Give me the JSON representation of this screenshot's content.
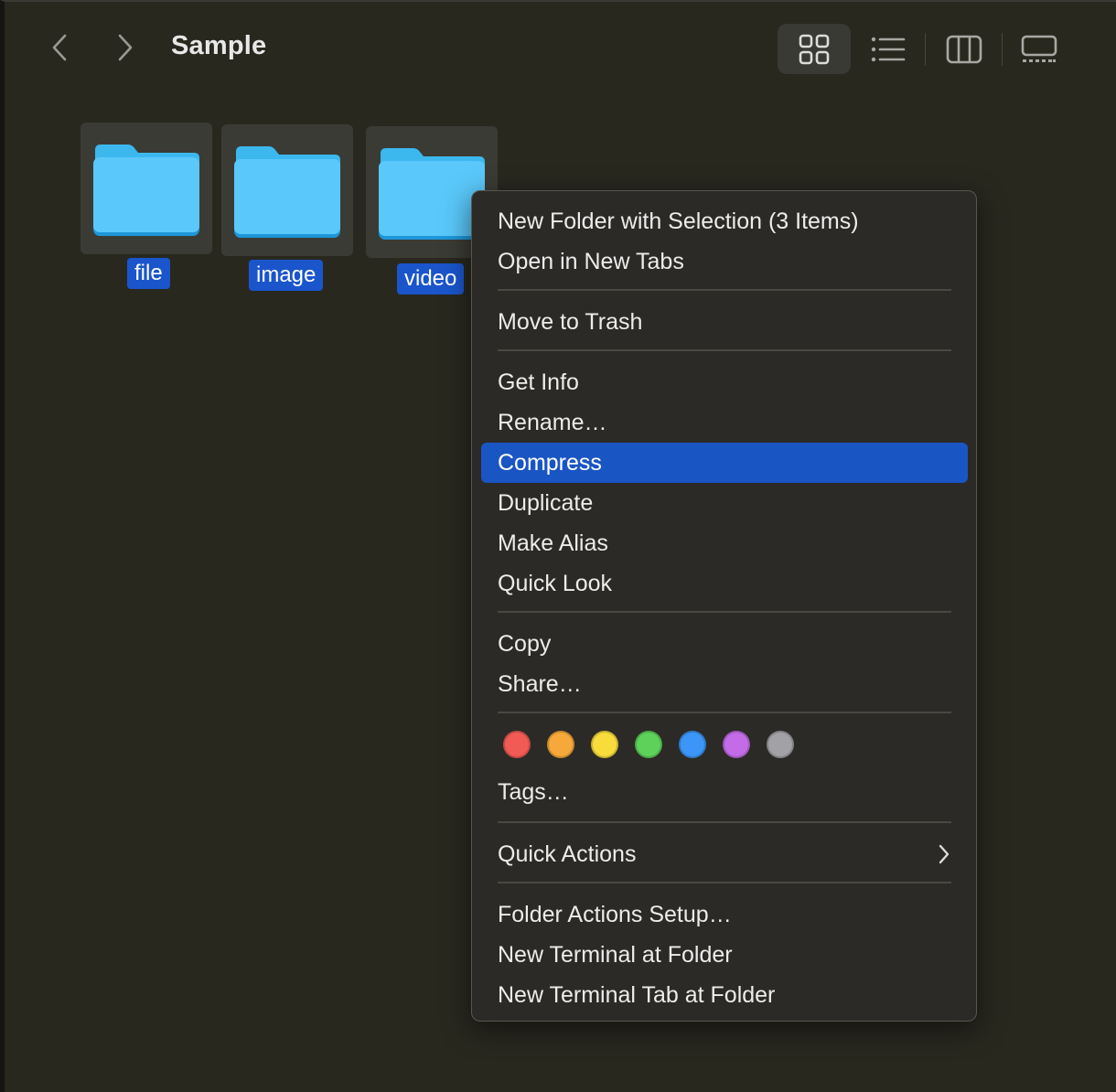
{
  "window": {
    "title": "Sample"
  },
  "toolbar": {
    "back_icon": "chevron-left-icon",
    "forward_icon": "chevron-right-icon",
    "views": [
      {
        "id": "icon",
        "icon": "grid-view-icon",
        "active": true
      },
      {
        "id": "list",
        "icon": "list-view-icon",
        "active": false
      },
      {
        "id": "column",
        "icon": "column-view-icon",
        "active": false
      },
      {
        "id": "gallery",
        "icon": "gallery-view-icon",
        "active": false
      }
    ]
  },
  "folders": [
    {
      "name": "file",
      "selected": true
    },
    {
      "name": "image",
      "selected": true
    },
    {
      "name": "video",
      "selected": true
    }
  ],
  "context_menu": {
    "items": [
      "New Folder with Selection (3 Items)",
      "Open in New Tabs",
      "Move to Trash",
      "Get Info",
      "Rename…",
      "Compress",
      "Duplicate",
      "Make Alias",
      "Quick Look",
      "Copy",
      "Share…",
      "Tags…",
      "Quick Actions",
      "Folder Actions Setup…",
      "New Terminal at Folder",
      "New Terminal Tab at Folder"
    ],
    "highlighted": "Compress",
    "tag_colors": [
      "#f25a56",
      "#f6a83a",
      "#f7dc3c",
      "#5dd15a",
      "#3c95f7",
      "#c46be8",
      "#a1a1a6"
    ]
  }
}
